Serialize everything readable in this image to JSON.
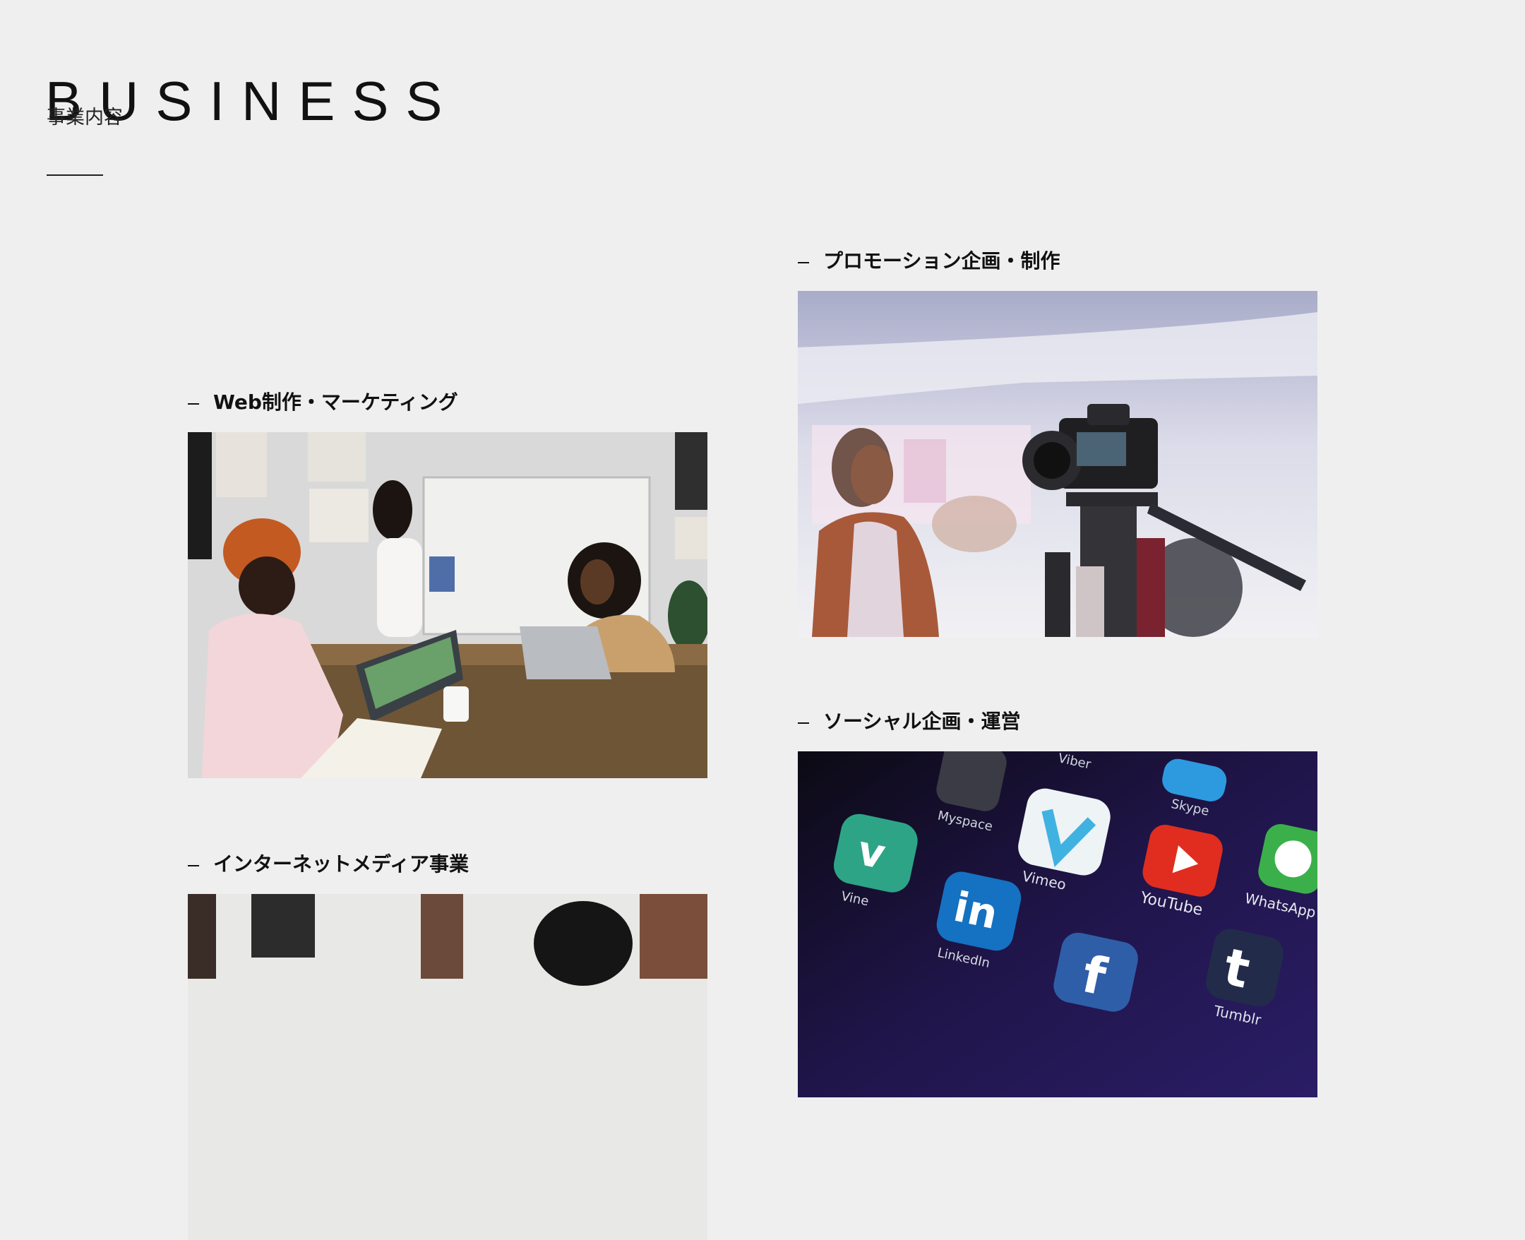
{
  "header": {
    "title": "BUSINESS",
    "subtitle": "事業内容"
  },
  "sections": {
    "promotion": {
      "title": "プロモーション企画・制作",
      "image": "camera-recording-photo"
    },
    "web": {
      "title": "Web制作・マーケティング",
      "image": "office-meeting-photo"
    },
    "social": {
      "title": "ソーシャル企画・運営",
      "image": "smartphone-social-apps-photo",
      "app_labels": [
        "Viber",
        "Skype",
        "Myspace",
        "Vimeo",
        "WhatsApp",
        "YouTube",
        "Tumblr",
        "Vine",
        "LinkedIn"
      ]
    },
    "media": {
      "title": "インターネットメディア事業",
      "image": "office-workspace-photo"
    }
  },
  "colors": {
    "background": "#efefef",
    "text": "#111111"
  }
}
